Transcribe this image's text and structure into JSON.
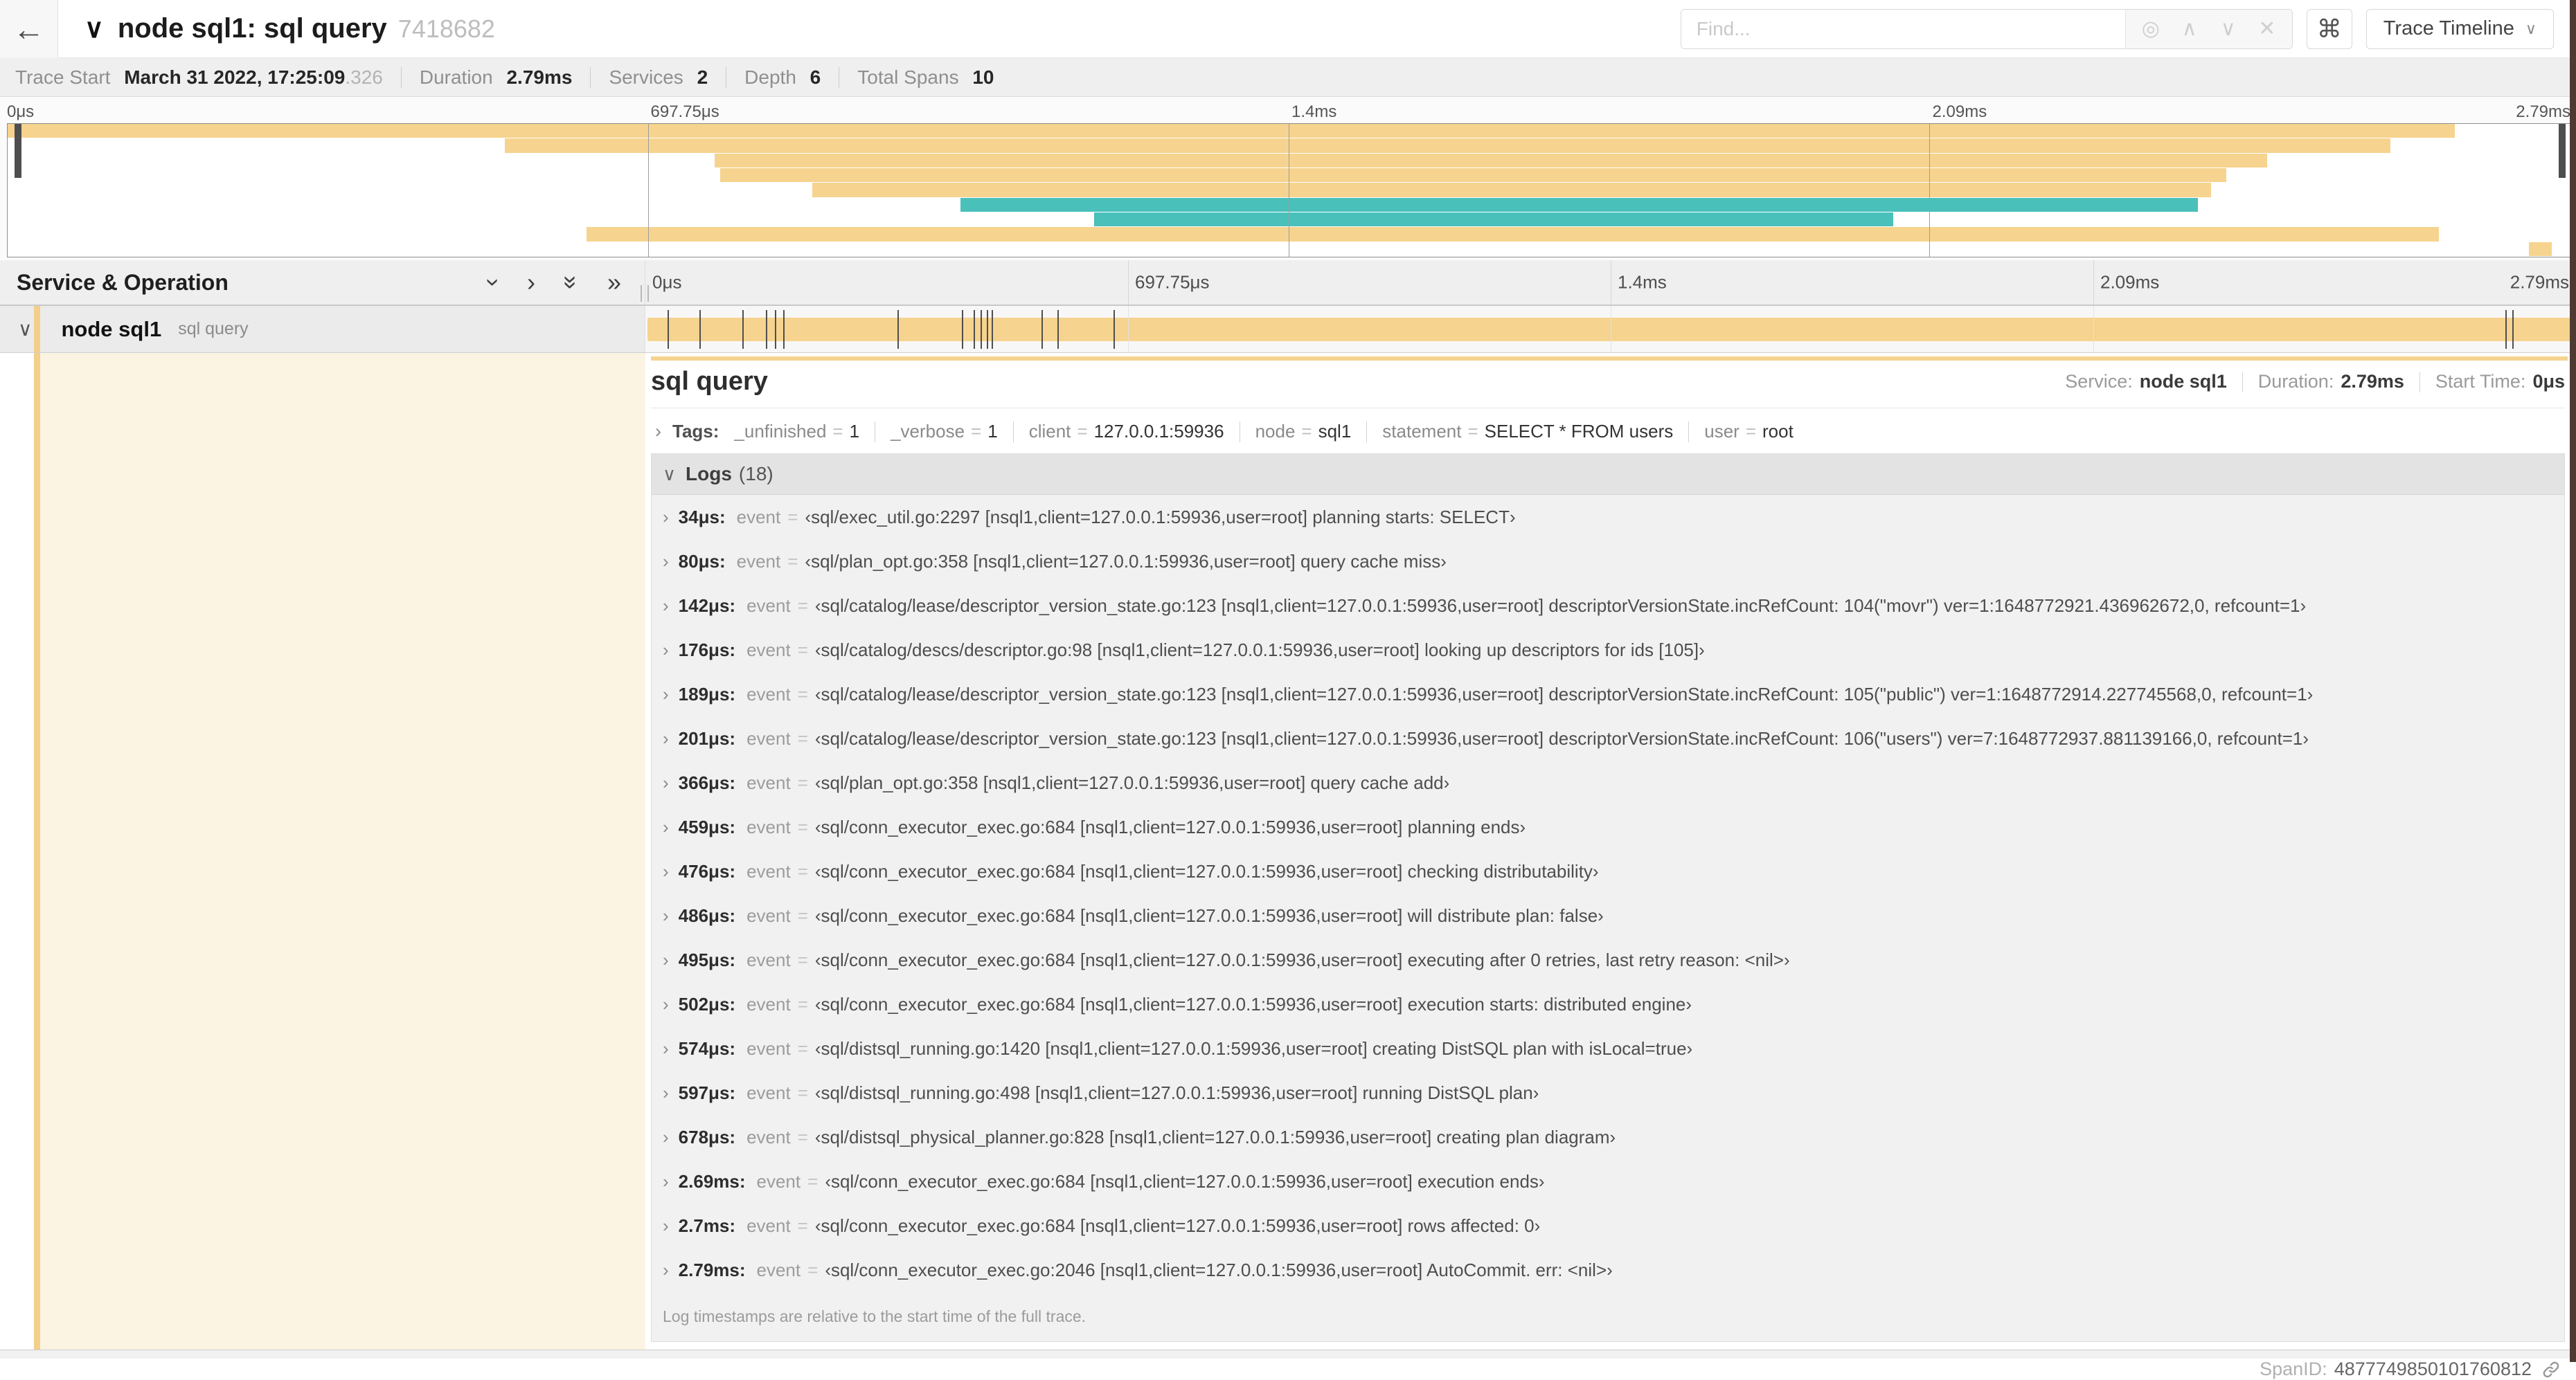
{
  "colors": {
    "span": "#F6D38E",
    "span_tint": "#FCF4E2",
    "teal": "#4AC0BA",
    "edge_strip": "#4F3A33"
  },
  "header": {
    "back_icon": "←",
    "collapse_icon": "∨",
    "title": "node sql1: sql query",
    "trace_id": "7418682",
    "find_placeholder": "Find...",
    "find_icons": [
      "◎",
      "∧",
      "∨",
      "✕"
    ],
    "shortcut_icon": "⌘",
    "view_button": "Trace Timeline",
    "view_button_chevron": "∨"
  },
  "trace_meta": {
    "items": [
      {
        "label": "Trace Start",
        "value": "March 31 2022, 17:25:09",
        "suffix": ".326"
      },
      {
        "label": "Duration",
        "value": "2.79ms"
      },
      {
        "label": "Services",
        "value": "2"
      },
      {
        "label": "Depth",
        "value": "6"
      },
      {
        "label": "Total Spans",
        "value": "10"
      }
    ]
  },
  "timeline": {
    "header_label": "Service & Operation",
    "ticks": [
      "0μs",
      "697.75μs",
      "1.4ms",
      "2.09ms",
      "2.79ms"
    ],
    "tick_positions": [
      0,
      25,
      50,
      75,
      100
    ],
    "collapse_icons": [
      {
        "name": "collapse-one-icon",
        "glyph": "›",
        "rot": true
      },
      {
        "name": "expand-one-icon",
        "glyph": "›",
        "rot": false
      },
      {
        "name": "collapse-all-icon",
        "glyph": "»",
        "rot": true
      },
      {
        "name": "expand-all-icon",
        "glyph": "»",
        "rot": false
      }
    ]
  },
  "minimap": {
    "spans": [
      {
        "left": 0,
        "width": 95.5,
        "color": "#F6D38E"
      },
      {
        "left": 19.4,
        "width": 73.6,
        "color": "#F6D38E"
      },
      {
        "left": 27.6,
        "width": 60.6,
        "color": "#F6D38E"
      },
      {
        "left": 27.8,
        "width": 58.8,
        "color": "#F6D38E"
      },
      {
        "left": 31.4,
        "width": 54.6,
        "color": "#F6D38E"
      },
      {
        "left": 37.2,
        "width": 48.3,
        "color": "#4AC0BA"
      },
      {
        "left": 42.4,
        "width": 31.2,
        "color": "#4AC0BA"
      },
      {
        "left": 22.6,
        "width": 72.3,
        "color": "#F6D38E"
      },
      {
        "left": 98.4,
        "width": 0.9,
        "color": "#F6D38E"
      }
    ]
  },
  "span_row": {
    "collapse_icon": "∨",
    "service": "node sql1",
    "operation": "sql query",
    "duration_us": 2790,
    "log_marks_us": [
      34,
      80,
      142,
      176,
      189,
      201,
      366,
      459,
      476,
      486,
      495,
      502,
      574,
      597,
      678,
      2690,
      2700,
      2790
    ]
  },
  "detail": {
    "title": "sql query",
    "meta": [
      {
        "label": "Service:",
        "value": "node sql1"
      },
      {
        "label": "Duration:",
        "value": "2.79ms"
      },
      {
        "label": "Start Time:",
        "value": "0μs"
      }
    ],
    "tags_chevron": "›",
    "tags_label": "Tags:",
    "tags": [
      {
        "key": "_unfinished",
        "value": "1"
      },
      {
        "key": "_verbose",
        "value": "1"
      },
      {
        "key": "client",
        "value": "127.0.0.1:59936"
      },
      {
        "key": "node",
        "value": "sql1"
      },
      {
        "key": "statement",
        "value": "SELECT * FROM users"
      },
      {
        "key": "user",
        "value": "root"
      }
    ],
    "logs_chevron": "∨",
    "logs_label": "Logs",
    "logs_count": "(18)",
    "logs": [
      {
        "time": "34μs:",
        "field": "event",
        "value": "‹sql/exec_util.go:2297 [nsql1,client=127.0.0.1:59936,user=root] planning starts: SELECT›"
      },
      {
        "time": "80μs:",
        "field": "event",
        "value": "‹sql/plan_opt.go:358 [nsql1,client=127.0.0.1:59936,user=root] query cache miss›"
      },
      {
        "time": "142μs:",
        "field": "event",
        "value": "‹sql/catalog/lease/descriptor_version_state.go:123 [nsql1,client=127.0.0.1:59936,user=root] descriptorVersionState.incRefCount: 104(\"movr\") ver=1:1648772921.436962672,0, refcount=1›"
      },
      {
        "time": "176μs:",
        "field": "event",
        "value": "‹sql/catalog/descs/descriptor.go:98 [nsql1,client=127.0.0.1:59936,user=root] looking up descriptors for ids [105]›"
      },
      {
        "time": "189μs:",
        "field": "event",
        "value": "‹sql/catalog/lease/descriptor_version_state.go:123 [nsql1,client=127.0.0.1:59936,user=root] descriptorVersionState.incRefCount: 105(\"public\") ver=1:1648772914.227745568,0, refcount=1›"
      },
      {
        "time": "201μs:",
        "field": "event",
        "value": "‹sql/catalog/lease/descriptor_version_state.go:123 [nsql1,client=127.0.0.1:59936,user=root] descriptorVersionState.incRefCount: 106(\"users\") ver=7:1648772937.881139166,0, refcount=1›"
      },
      {
        "time": "366μs:",
        "field": "event",
        "value": "‹sql/plan_opt.go:358 [nsql1,client=127.0.0.1:59936,user=root] query cache add›"
      },
      {
        "time": "459μs:",
        "field": "event",
        "value": "‹sql/conn_executor_exec.go:684 [nsql1,client=127.0.0.1:59936,user=root] planning ends›"
      },
      {
        "time": "476μs:",
        "field": "event",
        "value": "‹sql/conn_executor_exec.go:684 [nsql1,client=127.0.0.1:59936,user=root] checking distributability›"
      },
      {
        "time": "486μs:",
        "field": "event",
        "value": "‹sql/conn_executor_exec.go:684 [nsql1,client=127.0.0.1:59936,user=root] will distribute plan: false›"
      },
      {
        "time": "495μs:",
        "field": "event",
        "value": "‹sql/conn_executor_exec.go:684 [nsql1,client=127.0.0.1:59936,user=root] executing after 0 retries, last retry reason: <nil>›"
      },
      {
        "time": "502μs:",
        "field": "event",
        "value": "‹sql/conn_executor_exec.go:684 [nsql1,client=127.0.0.1:59936,user=root] execution starts: distributed engine›"
      },
      {
        "time": "574μs:",
        "field": "event",
        "value": "‹sql/distsql_running.go:1420 [nsql1,client=127.0.0.1:59936,user=root] creating DistSQL plan with isLocal=true›"
      },
      {
        "time": "597μs:",
        "field": "event",
        "value": "‹sql/distsql_running.go:498 [nsql1,client=127.0.0.1:59936,user=root] running DistSQL plan›"
      },
      {
        "time": "678μs:",
        "field": "event",
        "value": "‹sql/distsql_physical_planner.go:828 [nsql1,client=127.0.0.1:59936,user=root] creating plan diagram›"
      },
      {
        "time": "2.69ms:",
        "field": "event",
        "value": "‹sql/conn_executor_exec.go:684 [nsql1,client=127.0.0.1:59936,user=root] execution ends›"
      },
      {
        "time": "2.7ms:",
        "field": "event",
        "value": "‹sql/conn_executor_exec.go:684 [nsql1,client=127.0.0.1:59936,user=root] rows affected: 0›"
      },
      {
        "time": "2.79ms:",
        "field": "event",
        "value": "‹sql/conn_executor_exec.go:2046 [nsql1,client=127.0.0.1:59936,user=root] AutoCommit. err: <nil>›"
      }
    ],
    "logs_note": "Log timestamps are relative to the start time of the full trace.",
    "span_id_label": "SpanID:",
    "span_id": "4877749850101760812"
  }
}
